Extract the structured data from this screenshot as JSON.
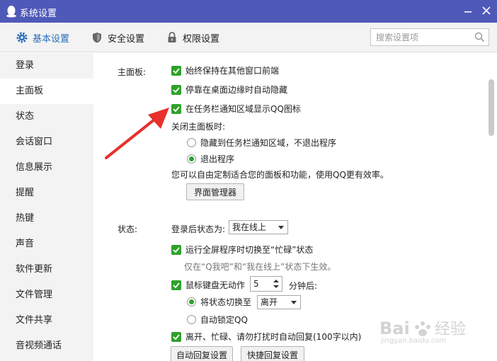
{
  "window": {
    "title": "系统设置"
  },
  "tabs": [
    {
      "label": "基本设置",
      "icon": "gear-icon"
    },
    {
      "label": "安全设置",
      "icon": "shield-icon"
    },
    {
      "label": "权限设置",
      "icon": "lock-icon"
    }
  ],
  "search": {
    "placeholder": "搜索设置项"
  },
  "sidebar": {
    "items": [
      {
        "label": "登录"
      },
      {
        "label": "主面板"
      },
      {
        "label": "状态"
      },
      {
        "label": "会话窗口"
      },
      {
        "label": "信息展示"
      },
      {
        "label": "提醒"
      },
      {
        "label": "热键"
      },
      {
        "label": "声音"
      },
      {
        "label": "软件更新"
      },
      {
        "label": "文件管理"
      },
      {
        "label": "文件共享"
      },
      {
        "label": "音视频通话"
      }
    ]
  },
  "main_panel": {
    "label": "主面板:",
    "always_on_top": "始终保持在其他窗口前端",
    "auto_hide": "停靠在桌面边缘时自动隐藏",
    "show_tray_icon": "在任务栏通知区域显示QQ图标",
    "close_title": "关闭主面板时:",
    "close_hide": "隐藏到任务栏通知区域，不退出程序",
    "close_exit": "退出程序",
    "customize_note": "您可以自由定制适合您的面板和功能，使用QQ更有效率。",
    "manager_button": "界面管理器"
  },
  "status": {
    "label": "状态:",
    "after_login_label": "登录后状态为:",
    "after_login_value": "我在线上",
    "fullscreen_busy": "运行全屏程序时切换至“忙碌”状态",
    "fullscreen_note": "仅在“Q我吧”和“我在线上”状态下生效。",
    "idle_label": "鼠标键盘无动作",
    "idle_minutes": "5",
    "idle_unit": "分钟后:",
    "switch_to_label": "将状态切换至",
    "switch_to_value": "离开",
    "auto_lock": "自动锁定QQ",
    "auto_reply": "离开、忙碌、请勿打扰时自动回复(100字以内)",
    "auto_reply_button": "自动回复设置",
    "quick_reply_button": "快捷回复设置"
  },
  "watermark": {
    "brand": "Bai",
    "brand_suffix": "经验",
    "url": "jingyan.baidu.com"
  }
}
